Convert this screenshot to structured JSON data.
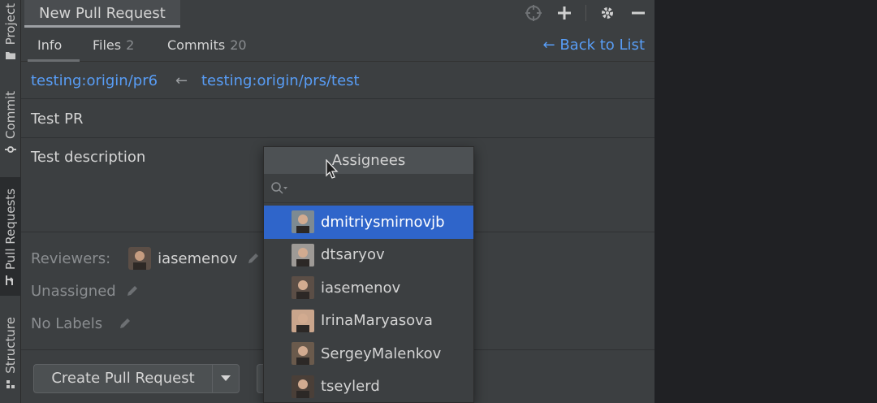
{
  "toolstrip": {
    "items": [
      {
        "label": "Project",
        "icon": "folder-icon"
      },
      {
        "label": "Commit",
        "icon": "commit-icon"
      },
      {
        "label": "Pull Requests",
        "icon": "pull-request-icon"
      },
      {
        "label": "Structure",
        "icon": "structure-icon"
      }
    ]
  },
  "titlebar": {
    "tab_title": "New Pull Request",
    "icons": [
      "crosshair-icon",
      "plus-icon",
      "gear-icon",
      "minimize-icon"
    ]
  },
  "subtabs": {
    "info_label": "Info",
    "files_label": "Files",
    "files_count": "2",
    "commits_label": "Commits",
    "commits_count": "20",
    "back_link": "← Back to List"
  },
  "branches": {
    "target": "testing:origin/pr6",
    "arrow": "←",
    "source": "testing:origin/prs/test"
  },
  "form": {
    "title": "Test PR",
    "description": "Test description",
    "reviewers_label": "Reviewers:",
    "reviewer_name": "iasemenov",
    "assignee_text": "Unassigned",
    "labels_text": "No Labels"
  },
  "actions": {
    "create_label": "Create Pull Request"
  },
  "popup": {
    "header": "Assignees",
    "search_placeholder": "",
    "items": [
      {
        "name": "dmitriysmirnovjb",
        "selected": true,
        "avatar_color": "#7d8a92"
      },
      {
        "name": "dtsaryov",
        "selected": false,
        "avatar_color": "#9e9a96"
      },
      {
        "name": "iasemenov",
        "selected": false,
        "avatar_color": "#5b4e46"
      },
      {
        "name": "IrinaMaryasova",
        "selected": false,
        "avatar_color": "#c9a58c"
      },
      {
        "name": "SergeyMalenkov",
        "selected": false,
        "avatar_color": "#6a5a4c"
      },
      {
        "name": "tseylerd",
        "selected": false,
        "avatar_color": "#4a3f38"
      }
    ]
  },
  "colors": {
    "accent_link": "#589df6",
    "selection": "#2f65ca",
    "panel_bg": "#3c3f41"
  }
}
